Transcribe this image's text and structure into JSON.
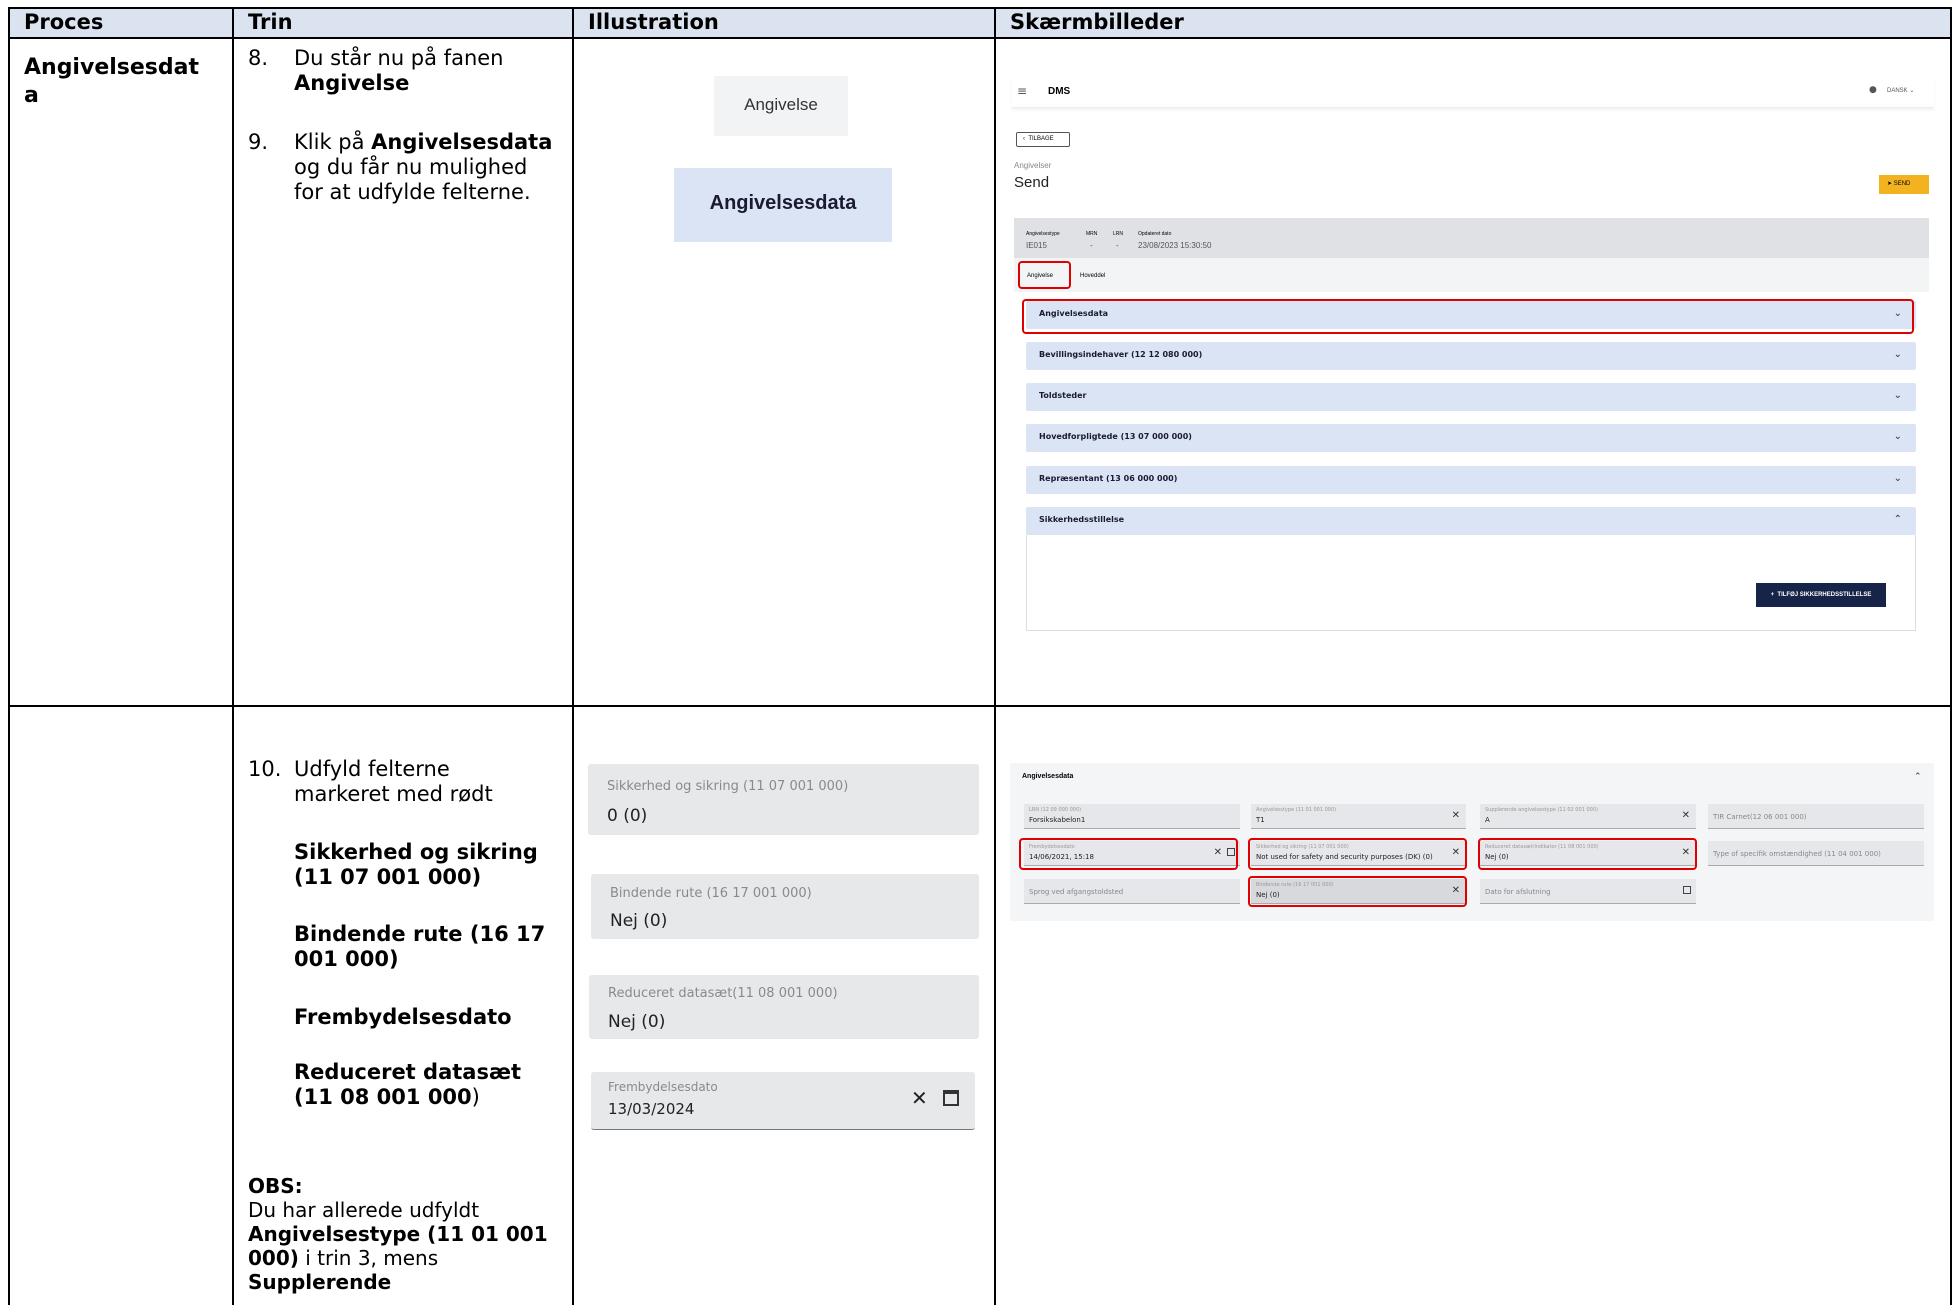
{
  "table": {
    "headers": [
      "Proces",
      "Trin",
      "Illustration",
      "Skærmbilleder"
    ],
    "row1": {
      "proces_line1": "Angivelsesdat",
      "proces_line2": "a",
      "steps": [
        {
          "num": "8.",
          "line1": "Du står nu på fanen",
          "bold1": "Angivelse"
        },
        {
          "num": "9.",
          "pre": "Klik på ",
          "bold": "Angivelsesdata",
          "line2": "og du får nu mulighed",
          "line3": "for at udfylde felterne."
        }
      ]
    },
    "row2": {
      "step10_num": "10.",
      "step10_line1": "Udfyld felterne",
      "step10_line2": "markeret med rødt",
      "bold_items": [
        [
          "Sikkerhed og sikring",
          "(11 07 001 000)"
        ],
        [
          "Bindende rute (16 17",
          "001 000)"
        ],
        [
          "Frembydelsesdato"
        ],
        [
          "Reduceret datasæt",
          "(11 08 001 000"
        ]
      ],
      "bold_item4_suffix": ")",
      "obs_label": "OBS:",
      "obs_line1": "Du har allerede udfyldt",
      "obs_bold1": "Angivelsestype (11 01 001",
      "obs_bold2": "000)",
      "obs_line3": " i trin 3, mens",
      "obs_bold3": "Supplerende"
    }
  },
  "illustration1": {
    "tab_label": "Angivelse",
    "button_label": "Angivelsesdata"
  },
  "illustration2": {
    "fields": [
      {
        "label": "Sikkerhed og sikring (11 07 001 000)",
        "value": "0 (0)"
      },
      {
        "label": "Bindende rute (16 17 001 000)",
        "value": "Nej (0)"
      },
      {
        "label": "Reduceret datasæt(11 08 001 000)",
        "value": "Nej (0)"
      },
      {
        "label": "Frembydelsesdato",
        "value": "13/03/2024"
      }
    ]
  },
  "screenshot1": {
    "app_title": "DMS",
    "language": "DANSK",
    "back_label": "TILBAGE",
    "breadcrumb": "Angivelser",
    "page_title": "Send",
    "send_label": "SEND",
    "meta_labels": [
      "Angivelsestype",
      "MRN",
      "LRN",
      "Opdateret dato"
    ],
    "meta_values": [
      "IE015",
      "-",
      "-",
      "23/08/2023 15:30:50"
    ],
    "tabs": [
      "Angivelse",
      "Hoveddel"
    ],
    "sections": [
      "Angivelsesdata",
      "Bevillingsindehaver (12 12 080 000)",
      "Toldsteder",
      "Hovedforpligtede (13 07 000 000)",
      "Repræsentant (13 06 000 000)",
      "Sikkerhedsstillelse"
    ],
    "add_button": "TILFØJ SIKKERHEDSSTILLELSE"
  },
  "screenshot2": {
    "section_title": "Angivelsesdata",
    "fields": [
      {
        "label": "LRN (12 09 000 000)",
        "value": "Forsikskabelon1"
      },
      {
        "label": "Angivelsestype (11 01 001 000)",
        "value": "T1"
      },
      {
        "label": "Supplerende angivelsestype (11 02 001 000)",
        "value": "A"
      },
      {
        "label": "",
        "value": "TIR Carnet(12 06 001 000)"
      },
      {
        "label": "Frembydelsesdato",
        "value": "14/06/2021, 15:18"
      },
      {
        "label": "Sikkerhed og sikring (11 07 001 000)",
        "value": "Not used for safety and security purposes (DK) (0)"
      },
      {
        "label": "Reduceret datasæt/indikator (11 08 001 000)",
        "value": "Nej (0)"
      },
      {
        "label": "",
        "value": "Type of specifik omstændighed (11 04 001 000)"
      },
      {
        "label": "",
        "value": "Sprog ved afgangstoldsted"
      },
      {
        "label": "Bindende rute (16 17 001 000)",
        "value": "Nej (0)"
      },
      {
        "label": "",
        "value": "Dato for afslutning"
      }
    ]
  }
}
